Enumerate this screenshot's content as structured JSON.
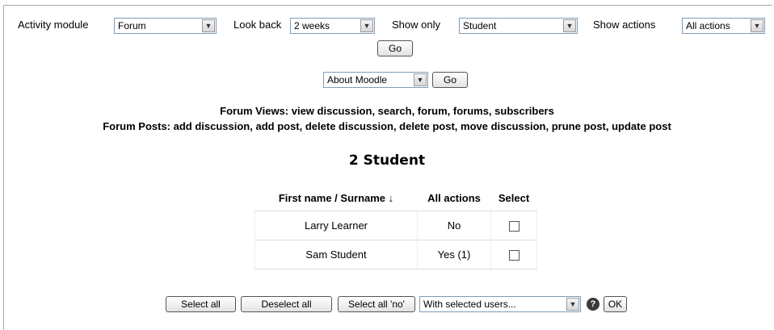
{
  "filters": {
    "activity_module_label": "Activity module",
    "activity_module_value": "Forum",
    "look_back_label": "Look back",
    "look_back_value": "2 weeks",
    "show_only_label": "Show only",
    "show_only_value": "Student",
    "show_actions_label": "Show actions",
    "show_actions_value": "All actions",
    "go_label": "Go"
  },
  "course_jump": {
    "value": "About Moodle",
    "go_label": "Go"
  },
  "info": {
    "forum_views": "Forum Views: view discussion, search, forum, forums, subscribers",
    "forum_posts": "Forum Posts: add discussion, add post, delete discussion, delete post, move discussion, prune post, update post"
  },
  "heading": "2 Student",
  "table": {
    "col_name": "First name / Surname",
    "sort_arrow": "↓",
    "col_actions": "All actions",
    "col_select": "Select",
    "rows": [
      {
        "name": "Larry Learner",
        "actions": "No"
      },
      {
        "name": "Sam Student",
        "actions": "Yes (1)"
      }
    ]
  },
  "bulk": {
    "select_all": "Select all",
    "deselect_all": "Deselect all",
    "select_all_no": "Select all 'no'",
    "with_selected_value": "With selected users...",
    "help_icon": "?",
    "ok": "OK"
  },
  "icons": {
    "dropdown": "chevron-down-icon",
    "help": "help-icon",
    "sort": "sort-down-arrow-icon"
  }
}
